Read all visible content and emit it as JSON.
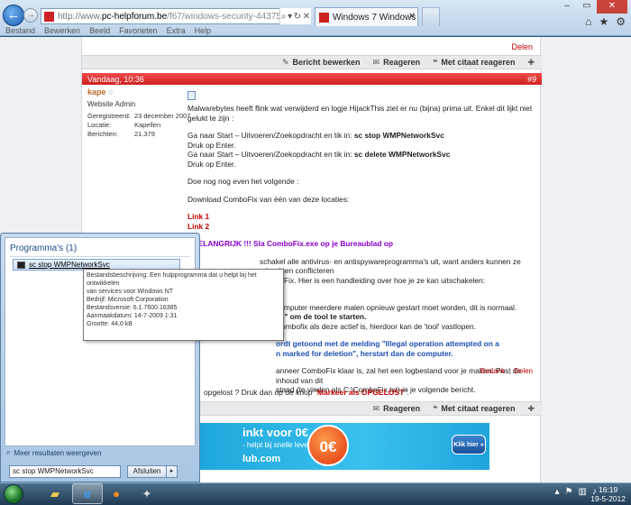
{
  "browser": {
    "url_prefix": "http://www.",
    "url_host": "pc-helpforum.be",
    "url_path": "/f67/windows-security-44375/",
    "tab_title": "Windows 7 Windows Security",
    "menu": [
      "Bestand",
      "Bewerken",
      "Beeld",
      "Favorieten",
      "Extra",
      "Help"
    ]
  },
  "forum": {
    "top_delen": "Delen",
    "actions": {
      "edit": "Bericht bewerken",
      "reply": "Reageren",
      "quote_reply": "Met citaat reageren"
    },
    "post": {
      "date": "Vandaag, 10:36",
      "number": "#9",
      "user": {
        "name": "kape",
        "role": "Website Admin",
        "fields": [
          {
            "label": "Geregistreerd:",
            "value": "23 december 2007"
          },
          {
            "label": "Locatie:",
            "value": "Kapellen"
          },
          {
            "label": "Berichten:",
            "value": "21.379"
          }
        ]
      },
      "p1": "Malwarebytes heeft flink wat verwijderd en logje HijackThis ziet er nu (bijna) prima uit. Enkel dit lijkt niet gelukt te zijn :",
      "p2a": "Ga naar Start – Uitvoeren/Zoekopdracht en tik in: ",
      "p2b": "sc stop WMPNetworkSvc",
      "p2c": "Druk op Enter.",
      "p2d": "Ga naar Start – Uitvoeren/Zoekopdracht en tik in: ",
      "p2e": "sc delete WMPNetworkSvc",
      "p2f": "Druk op Enter.",
      "p3": "Doe nog nog even het volgende :",
      "p4": "Download ComboFix van één van deze locaties:",
      "link1": "Link 1",
      "link2": "Link 2",
      "belangrijk": "* BELANGRIJK !!! Sla ComboFix.exe op je Bureaublad op",
      "p6a": "schakel alle antivirus- en antispywareprogramma's uit, want anders kunnen ze misschien conflicteren",
      "p6b": "ComboFix. Hier is een handleiding over hoe je ze kan uitschakelen:",
      "p6c": "hier",
      "p7a": "computer meerdere malen opnieuw gestart moet worden, dit is normaal.",
      "p7b": "xe\" om de tool te starten.",
      "p7c": "Combofix als deze actief is, hierdoor kan de 'tool' vastlopen.",
      "p8a": "ordt getoond met de melding \"Illegal operation attempted on a",
      "p8b": "n marked for deletion\", herstart dan de computer.",
      "p9a": "anneer ComboFix klaar is, zal het een logbestand voor je maken. Post de inhoud van dit",
      "p9b": "stand (te vinden als C:\\ComboFix.txt) in je volgende bericht."
    },
    "bedank": "Bedank",
    "delen": "Delen",
    "solved_prefix": "opgelost ? Druk dan op de knop \"",
    "solved_mark": "Markeer als OPGELOST",
    "solved_suffix": "\"."
  },
  "ad": {
    "title": "inkt voor 0€",
    "sub": "- helpt bij snelle leveringen",
    "brand": "lub.com",
    "circle": "0€",
    "cta": "Klik hier »"
  },
  "startmenu": {
    "heading": "Programma's (1)",
    "result": "sc stop WMPNetworkSvc",
    "more": "Meer resultaten weergeven",
    "search_value": "sc stop WMPNetworkSvc",
    "shutdown": "Afsluiten"
  },
  "tooltip": {
    "lines": [
      "Bestandsbeschrijving: Een hulpprogramma dat u helpt bij het ontwikkelen",
      "van services voor Windows NT",
      "Bedrijf: Microsoft Corporation",
      "Bestandsversie: 6.1.7600.16385",
      "Aanmaakdatum: 14-7-2009 1:31",
      "Grootte: 44,0 kB"
    ]
  },
  "clock": {
    "time": "16:19",
    "date": "19-5-2012"
  }
}
